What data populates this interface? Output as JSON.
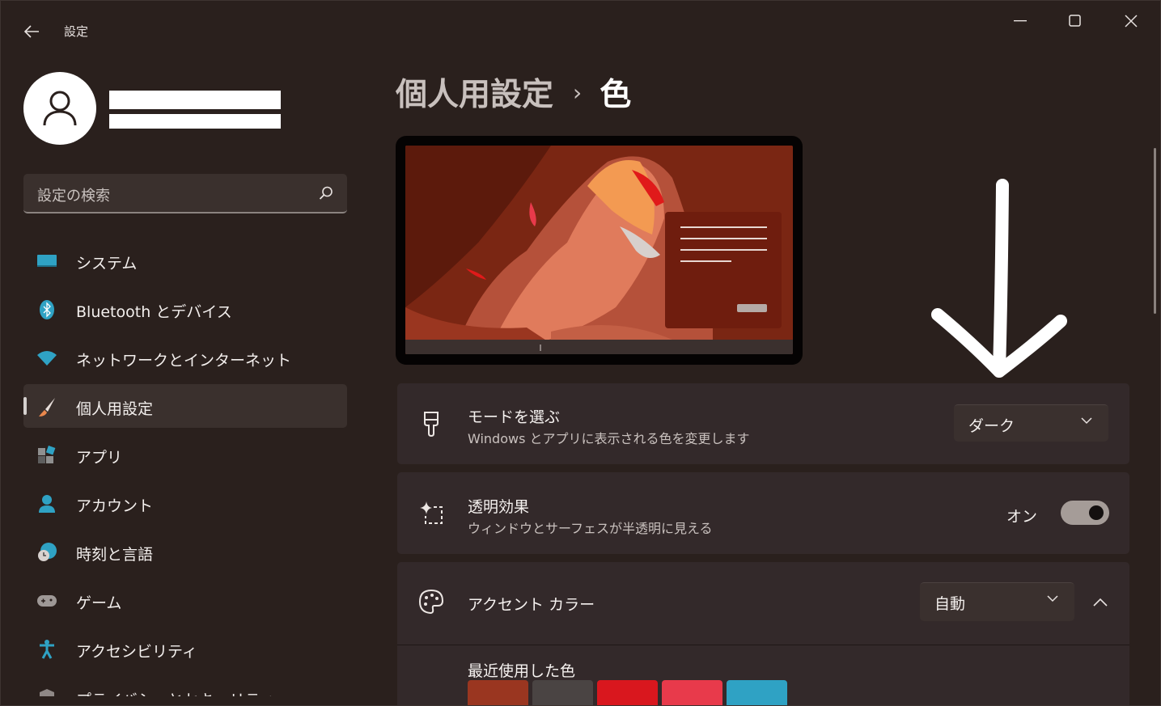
{
  "window": {
    "title": "設定",
    "controls": [
      "minimize-icon",
      "maximize-icon",
      "close-icon"
    ]
  },
  "search": {
    "placeholder": "設定の検索"
  },
  "sidebar": {
    "items": [
      {
        "label": "システム",
        "icon": "system-icon"
      },
      {
        "label": "Bluetooth とデバイス",
        "icon": "bluetooth-icon"
      },
      {
        "label": "ネットワークとインターネット",
        "icon": "wifi-icon"
      },
      {
        "label": "個人用設定",
        "icon": "brush-icon",
        "active": true
      },
      {
        "label": "アプリ",
        "icon": "apps-icon"
      },
      {
        "label": "アカウント",
        "icon": "account-icon"
      },
      {
        "label": "時刻と言語",
        "icon": "time-language-icon"
      },
      {
        "label": "ゲーム",
        "icon": "gamepad-icon"
      },
      {
        "label": "アクセシビリティ",
        "icon": "accessibility-icon"
      },
      {
        "label": "プライバシーとセキュリティ",
        "icon": "shield-icon"
      }
    ]
  },
  "breadcrumb": {
    "parent": "個人用設定",
    "separator": "›",
    "current": "色"
  },
  "mode_card": {
    "title": "モードを選ぶ",
    "subtitle": "Windows とアプリに表示される色を変更します",
    "value": "ダーク"
  },
  "transparency_card": {
    "title": "透明効果",
    "subtitle": "ウィンドウとサーフェスが半透明に見える",
    "toggle_label": "オン",
    "toggle_on": true
  },
  "accent_card": {
    "title": "アクセント カラー",
    "value": "自動",
    "recent_label": "最近使用した色",
    "recent_colors": [
      "#9a3620",
      "#4a4443",
      "#d9171e",
      "#e83a4b",
      "#2fa2c4"
    ]
  },
  "colors": {
    "background": "#2a201d",
    "card": "#33292a",
    "accent": "#d4d0ce"
  }
}
